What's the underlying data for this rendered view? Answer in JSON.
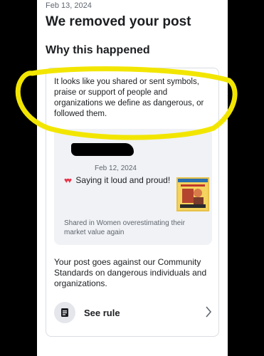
{
  "header": {
    "date": "Feb 13, 2024",
    "title": "We removed your post"
  },
  "reason": {
    "heading": "Why this happened",
    "explanation": "It looks like you shared or sent symbols, praise or support of people and organizations we define as dangerous, or followed them."
  },
  "post": {
    "date": "Feb 12, 2024",
    "hearts": "♥♥",
    "text": "Saying it loud and proud!",
    "shared_in": "Shared in Women overestimating their market value again"
  },
  "standards_text": "Your post goes against our Community Standards on dangerous individuals and organizations.",
  "see_rule": {
    "label": "See rule",
    "icon": "rule-book-icon"
  },
  "colors": {
    "highlight": "#f2e600",
    "background": "#000000",
    "card_border": "#dadde1",
    "post_box": "#f0f2f5",
    "heart": "#e8334a"
  }
}
